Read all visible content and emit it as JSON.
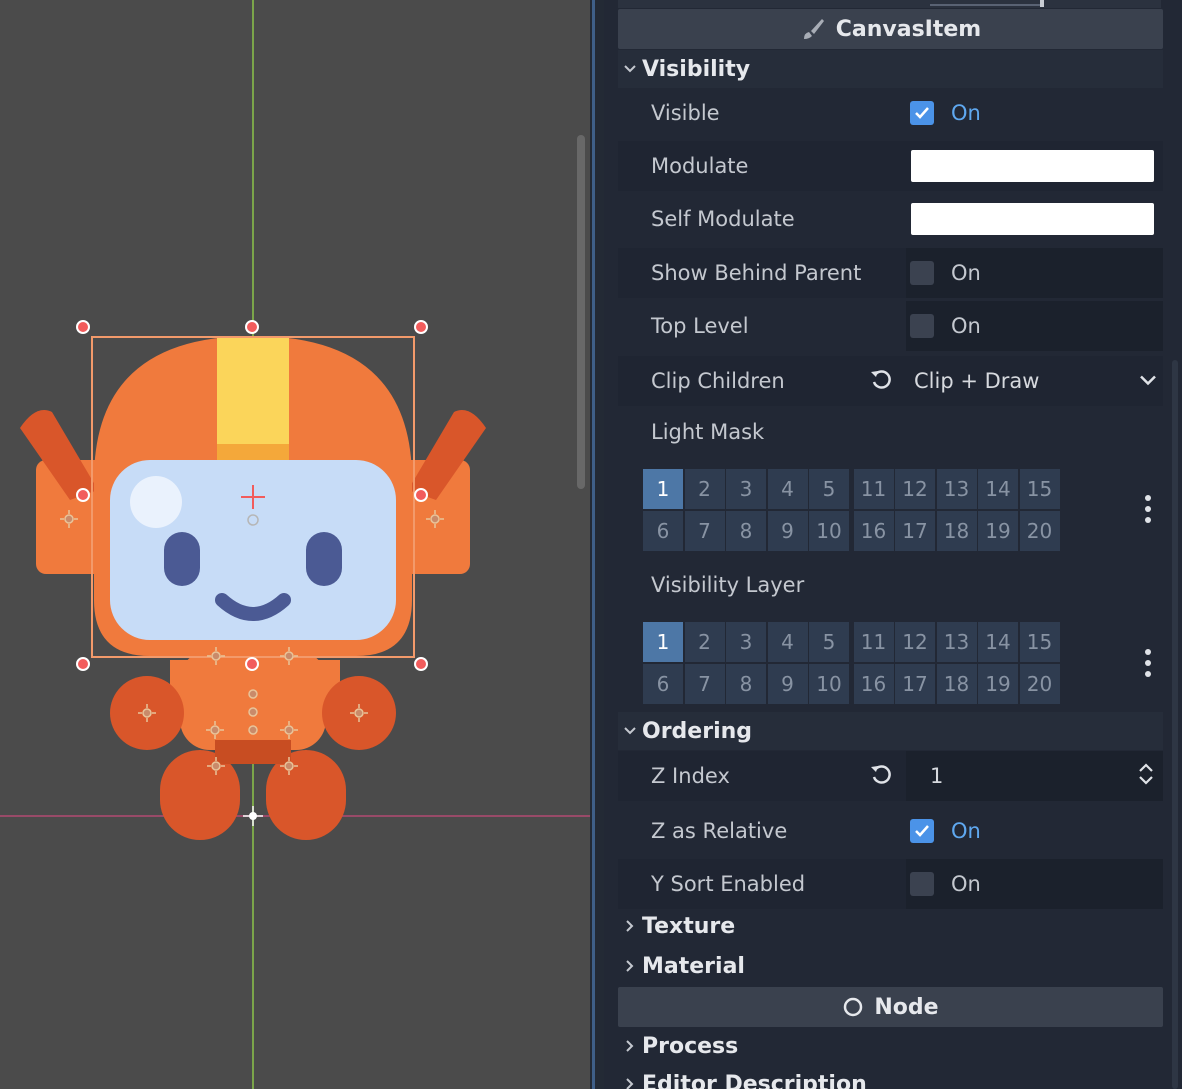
{
  "inspector": {
    "class_header": "CanvasItem",
    "class_header_icon": "brush-icon",
    "sections": {
      "visibility": "Visibility",
      "ordering": "Ordering",
      "texture": "Texture",
      "material": "Material",
      "process": "Process",
      "editor_description": "Editor Description"
    },
    "properties": {
      "visible": {
        "label": "Visible",
        "checked": true,
        "text": "On"
      },
      "modulate": {
        "label": "Modulate",
        "color": "#ffffff"
      },
      "self_modulate": {
        "label": "Self Modulate",
        "color": "#ffffff"
      },
      "show_behind_parent": {
        "label": "Show Behind Parent",
        "checked": false,
        "text": "On"
      },
      "top_level": {
        "label": "Top Level",
        "checked": false,
        "text": "On"
      },
      "clip_children": {
        "label": "Clip Children",
        "value": "Clip + Draw"
      },
      "light_mask": {
        "label": "Light Mask",
        "active": [
          1
        ]
      },
      "visibility_layer": {
        "label": "Visibility Layer",
        "active": [
          1
        ]
      },
      "z_index": {
        "label": "Z Index",
        "value": "1"
      },
      "z_as_relative": {
        "label": "Z as Relative",
        "checked": true,
        "text": "On"
      },
      "y_sort_enabled": {
        "label": "Y Sort Enabled",
        "checked": false,
        "text": "On"
      }
    },
    "layer_numbers": {
      "top": [
        "1",
        "2",
        "3",
        "4",
        "5",
        "11",
        "12",
        "13",
        "14",
        "15"
      ],
      "bottom": [
        "6",
        "7",
        "8",
        "9",
        "10",
        "16",
        "17",
        "18",
        "19",
        "20"
      ]
    },
    "node_header": "Node",
    "node_header_icon": "node-circle-icon"
  },
  "colors": {
    "accent": "#4b93e8",
    "on_text": "#5fa8f0",
    "layer_active": "#4d77a6",
    "robot_orange": "#f07a3d",
    "robot_dark_orange": "#d9562a",
    "robot_face": "#c7dcf7",
    "robot_stripe": "#fbd55a",
    "guide_green": "#8fce44",
    "guide_pink": "#c84a7a"
  }
}
